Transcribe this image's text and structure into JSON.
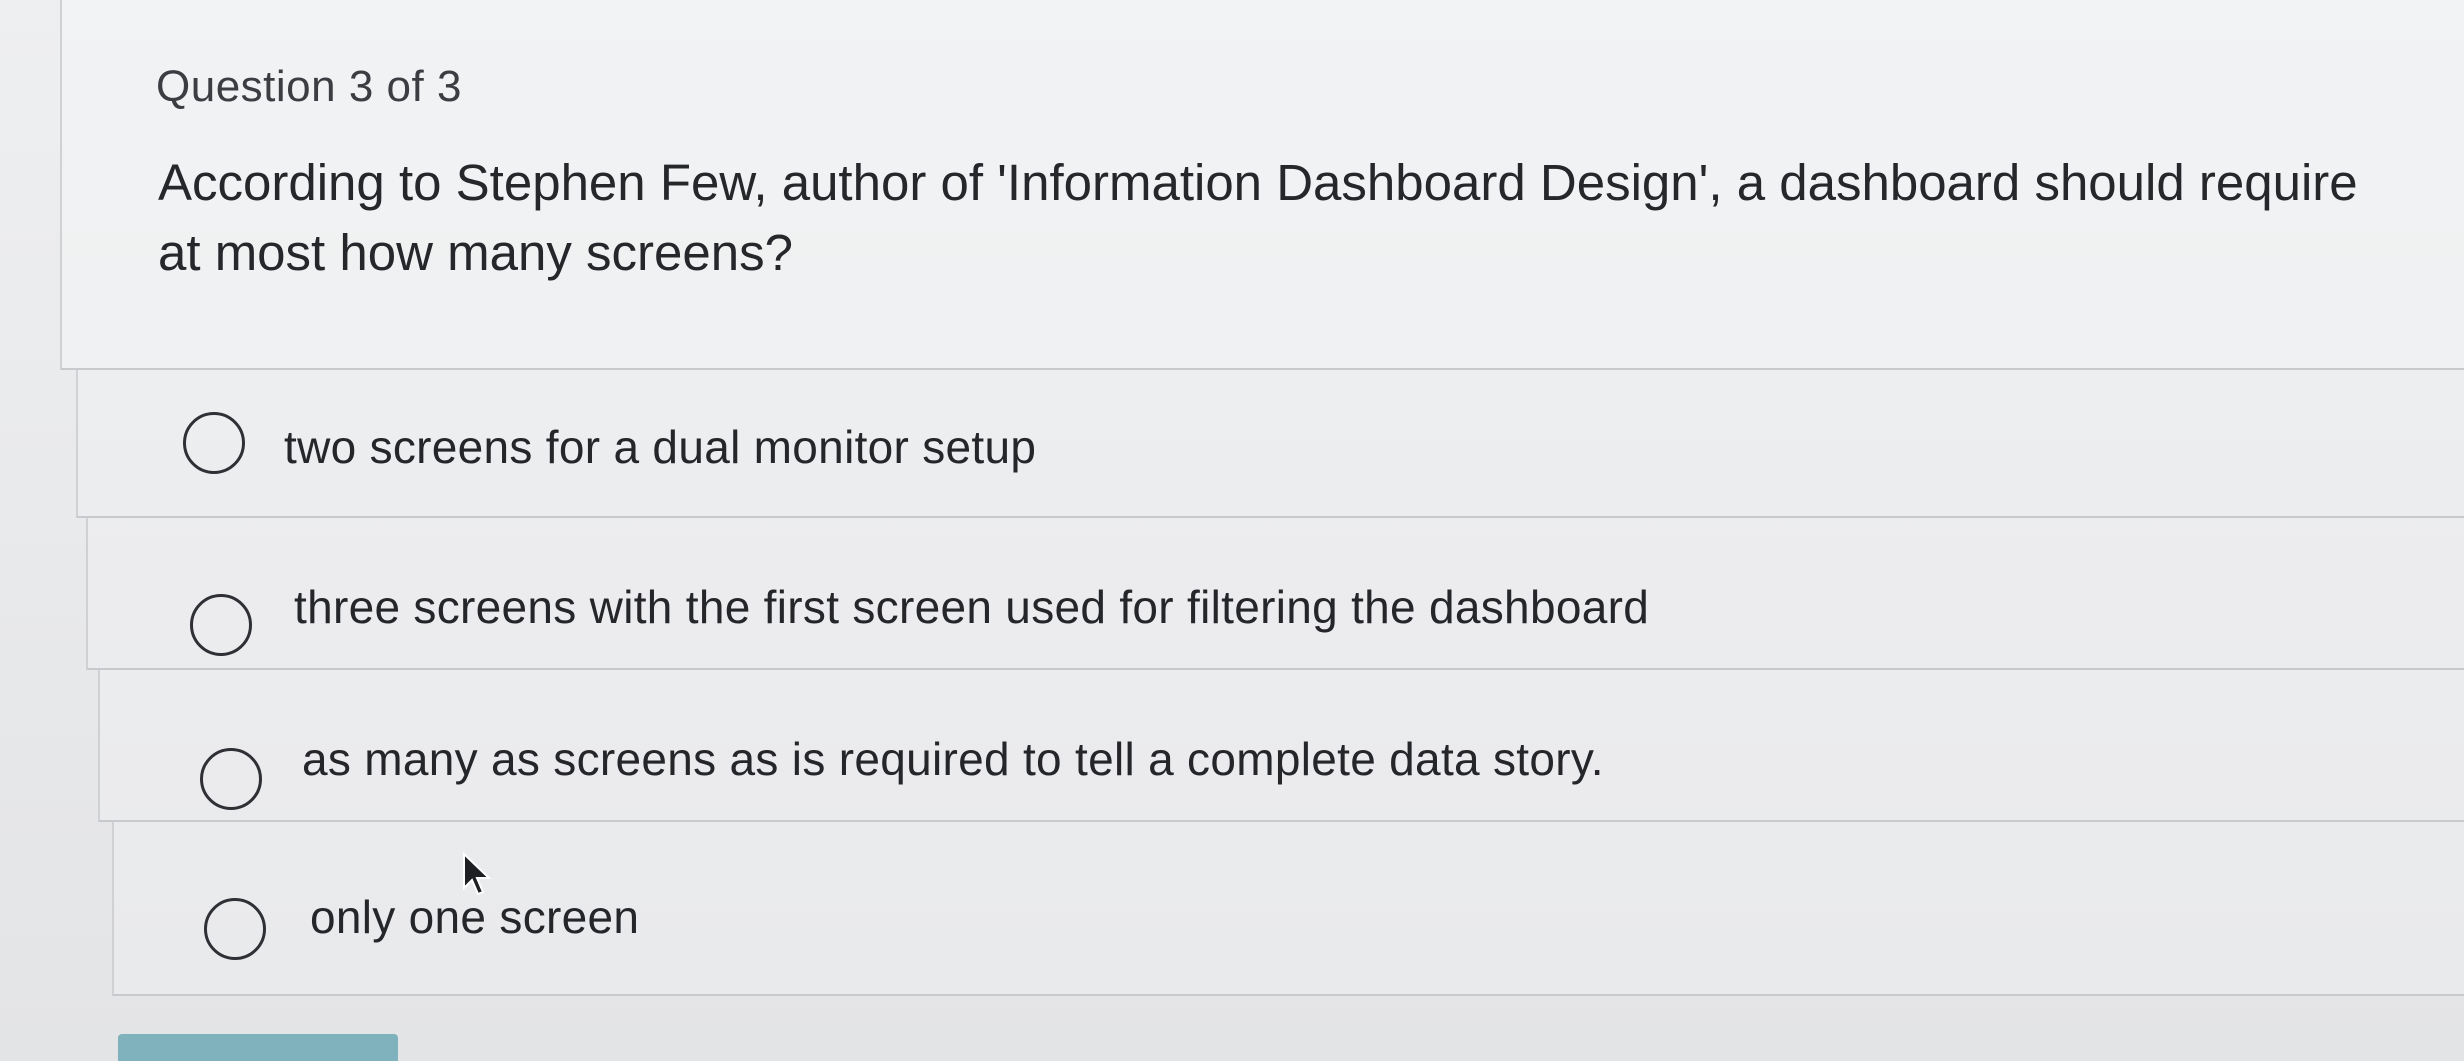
{
  "quiz": {
    "question_counter": "Question 3 of 3",
    "question_text": "According to Stephen Few, author of 'Information Dashboard Design', a dashboard should require at most how many screens?",
    "options": [
      {
        "label": "two screens for a dual monitor setup",
        "selected": false
      },
      {
        "label": "three screens with the first screen used for filtering the dashboard",
        "selected": false
      },
      {
        "label": "as many as screens as is required to tell a complete data story.",
        "selected": false
      },
      {
        "label": "only one screen",
        "selected": false
      }
    ]
  },
  "colors": {
    "background": "#e9eaec",
    "text": "#25272b",
    "radio_border": "#2e3035",
    "submit_button": "#7fb2bd"
  },
  "icons": {
    "cursor": "mouse-pointer-icon"
  }
}
